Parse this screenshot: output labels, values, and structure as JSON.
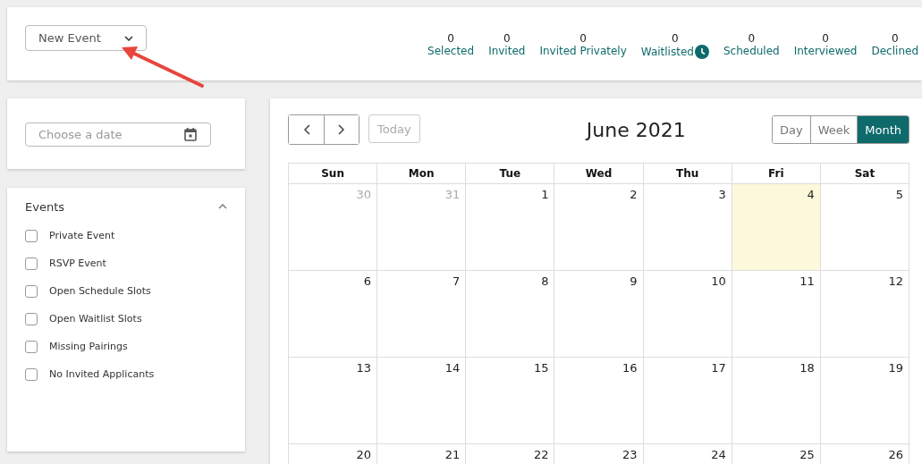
{
  "new_event": {
    "label": "New Event"
  },
  "stats": [
    {
      "count": "0",
      "label": "Selected",
      "kind": "plain"
    },
    {
      "count": "0",
      "label": "Invited",
      "kind": "plain"
    },
    {
      "count": "0",
      "label": "Invited Privately",
      "kind": "plain"
    },
    {
      "count": "0",
      "label": "Waitlisted",
      "kind": "clock"
    },
    {
      "count": "0",
      "label": "Scheduled",
      "kind": "plain"
    },
    {
      "count": "0",
      "label": "Interviewed",
      "kind": "plain"
    },
    {
      "count": "0",
      "label": "Declined",
      "kind": "plain"
    }
  ],
  "date_picker": {
    "placeholder": "Choose a date"
  },
  "events_panel": {
    "title": "Events",
    "expanded": true,
    "items": [
      {
        "label": "Private Event",
        "checked": false
      },
      {
        "label": "RSVP Event",
        "checked": false
      },
      {
        "label": "Open Schedule Slots",
        "checked": false
      },
      {
        "label": "Open Waitlist Slots",
        "checked": false
      },
      {
        "label": "Missing Pairings",
        "checked": false
      },
      {
        "label": "No Invited Applicants",
        "checked": false
      }
    ]
  },
  "calendar": {
    "today_button": "Today",
    "title": "June 2021",
    "views": [
      {
        "label": "Day",
        "selected": false
      },
      {
        "label": "Week",
        "selected": false
      },
      {
        "label": "Month",
        "selected": true
      }
    ],
    "weekdays": [
      "Sun",
      "Mon",
      "Tue",
      "Wed",
      "Thu",
      "Fri",
      "Sat"
    ],
    "weeks": [
      [
        {
          "day": "30",
          "outside": true,
          "today": false
        },
        {
          "day": "31",
          "outside": true,
          "today": false
        },
        {
          "day": "1",
          "outside": false,
          "today": false
        },
        {
          "day": "2",
          "outside": false,
          "today": false
        },
        {
          "day": "3",
          "outside": false,
          "today": false
        },
        {
          "day": "4",
          "outside": false,
          "today": true
        },
        {
          "day": "5",
          "outside": false,
          "today": false
        }
      ],
      [
        {
          "day": "6",
          "outside": false,
          "today": false
        },
        {
          "day": "7",
          "outside": false,
          "today": false
        },
        {
          "day": "8",
          "outside": false,
          "today": false
        },
        {
          "day": "9",
          "outside": false,
          "today": false
        },
        {
          "day": "10",
          "outside": false,
          "today": false
        },
        {
          "day": "11",
          "outside": false,
          "today": false
        },
        {
          "day": "12",
          "outside": false,
          "today": false
        }
      ],
      [
        {
          "day": "13",
          "outside": false,
          "today": false
        },
        {
          "day": "14",
          "outside": false,
          "today": false
        },
        {
          "day": "15",
          "outside": false,
          "today": false
        },
        {
          "day": "16",
          "outside": false,
          "today": false
        },
        {
          "day": "17",
          "outside": false,
          "today": false
        },
        {
          "day": "18",
          "outside": false,
          "today": false
        },
        {
          "day": "19",
          "outside": false,
          "today": false
        }
      ],
      [
        {
          "day": "20",
          "outside": false,
          "today": false
        },
        {
          "day": "21",
          "outside": false,
          "today": false
        },
        {
          "day": "22",
          "outside": false,
          "today": false
        },
        {
          "day": "23",
          "outside": false,
          "today": false
        },
        {
          "day": "24",
          "outside": false,
          "today": false
        },
        {
          "day": "25",
          "outside": false,
          "today": false
        },
        {
          "day": "26",
          "outside": false,
          "today": false
        }
      ]
    ]
  }
}
